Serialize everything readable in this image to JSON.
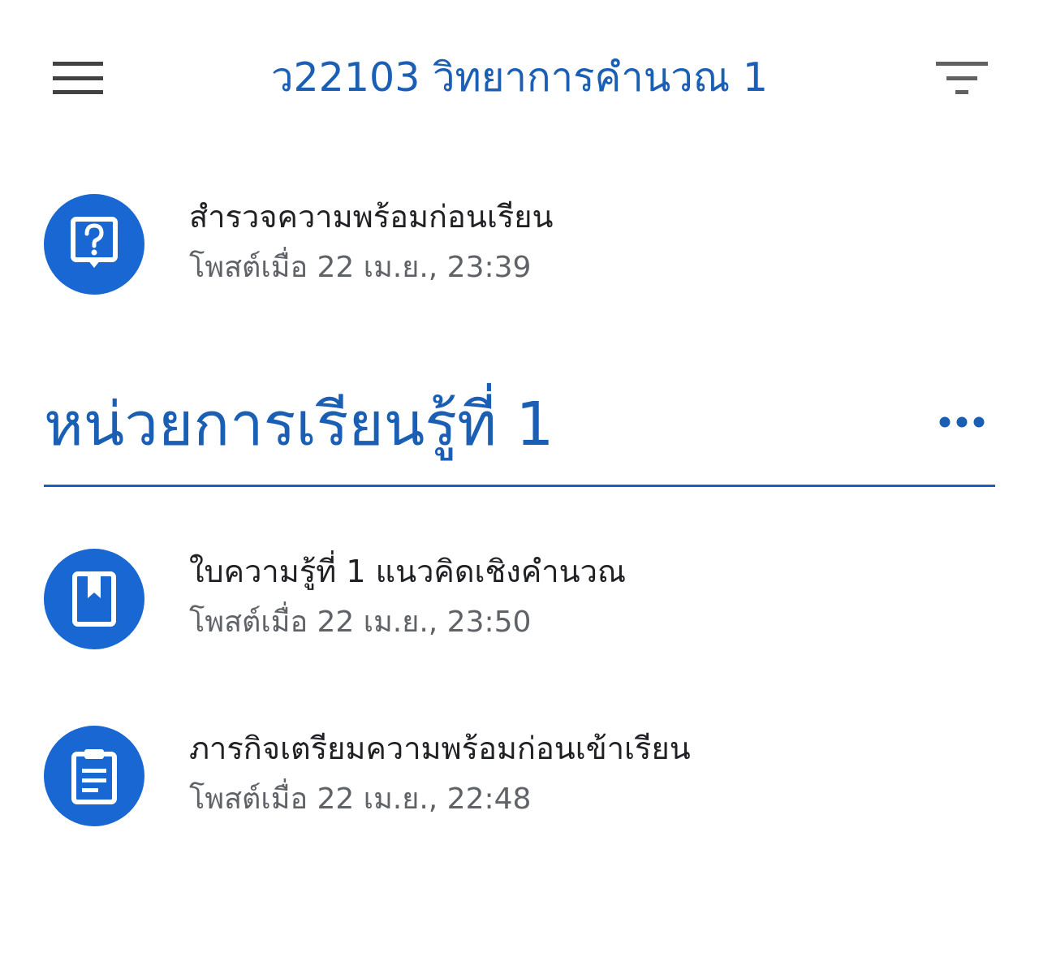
{
  "header": {
    "title": "ว22103 วิทยาการคำนวณ 1"
  },
  "colors": {
    "accent": "#1a5fb4",
    "icon_bg": "#1967d2"
  },
  "top_items": [
    {
      "title": "สำรวจความพร้อมก่อนเรียน",
      "posted": "โพสต์เมื่อ 22 เม.ย., 23:39",
      "icon": "question-icon"
    }
  ],
  "section": {
    "title": "หน่วยการเรียนรู้ที่ 1",
    "items": [
      {
        "title": "ใบความรู้ที่ 1 แนวคิดเชิงคำนวณ",
        "posted": "โพสต์เมื่อ 22 เม.ย., 23:50",
        "icon": "material-icon"
      },
      {
        "title": "ภารกิจเตรียมความพร้อมก่อนเข้าเรียน",
        "posted": "โพสต์เมื่อ 22 เม.ย., 22:48",
        "icon": "assignment-icon"
      }
    ]
  }
}
